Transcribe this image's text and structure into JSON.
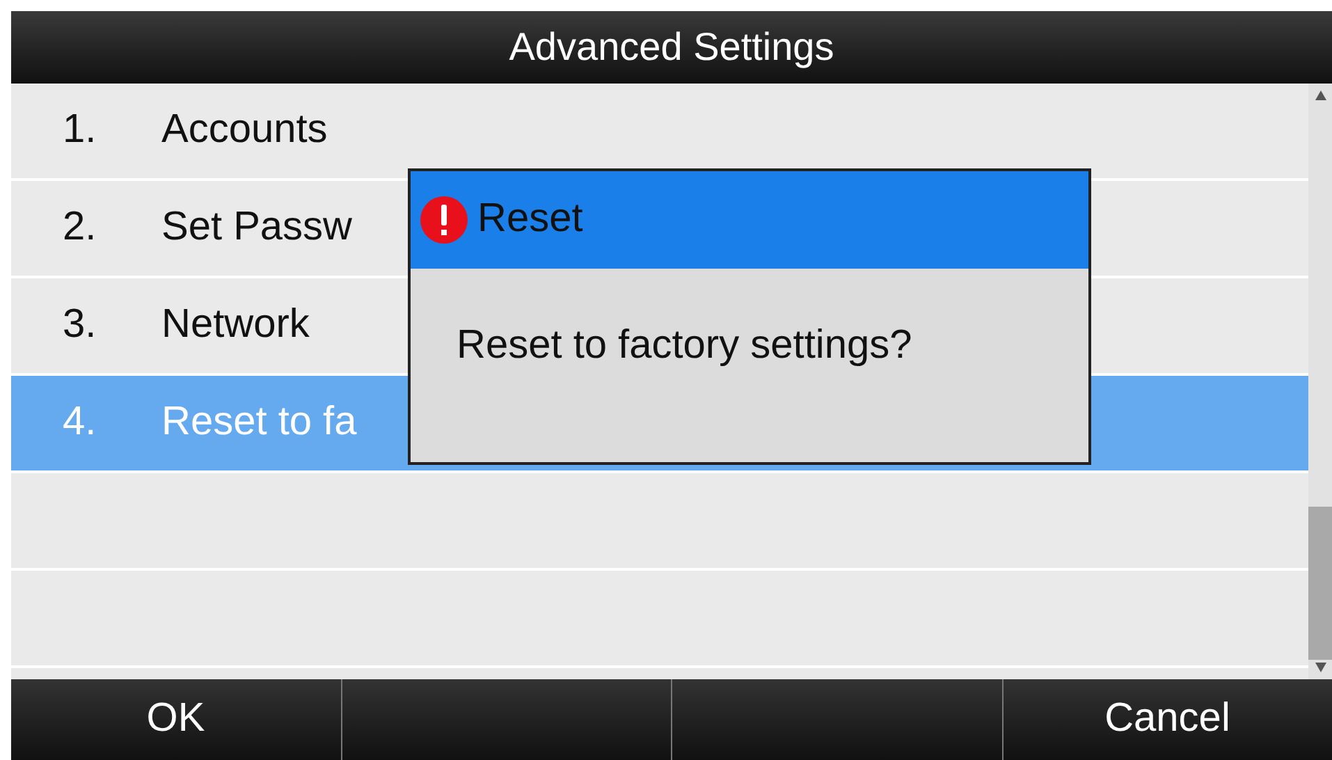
{
  "title": "Advanced Settings",
  "rows": [
    {
      "kind": "item",
      "number": "1.",
      "label": "Accounts",
      "selected": false
    },
    {
      "kind": "item",
      "number": "2.",
      "label": "Set Passw",
      "selected": false
    },
    {
      "kind": "item",
      "number": "3.",
      "label": "Network",
      "selected": false
    },
    {
      "kind": "item",
      "number": "4.",
      "label": "Reset to fa",
      "selected": true
    },
    {
      "kind": "empty",
      "selected": false
    },
    {
      "kind": "empty",
      "selected": false
    }
  ],
  "dialog": {
    "title": "Reset",
    "message": "Reset to factory settings?"
  },
  "softkeys": [
    {
      "kind": "key",
      "label": "OK"
    },
    {
      "kind": "blank"
    },
    {
      "kind": "blank"
    },
    {
      "kind": "key",
      "label": "Cancel"
    }
  ]
}
